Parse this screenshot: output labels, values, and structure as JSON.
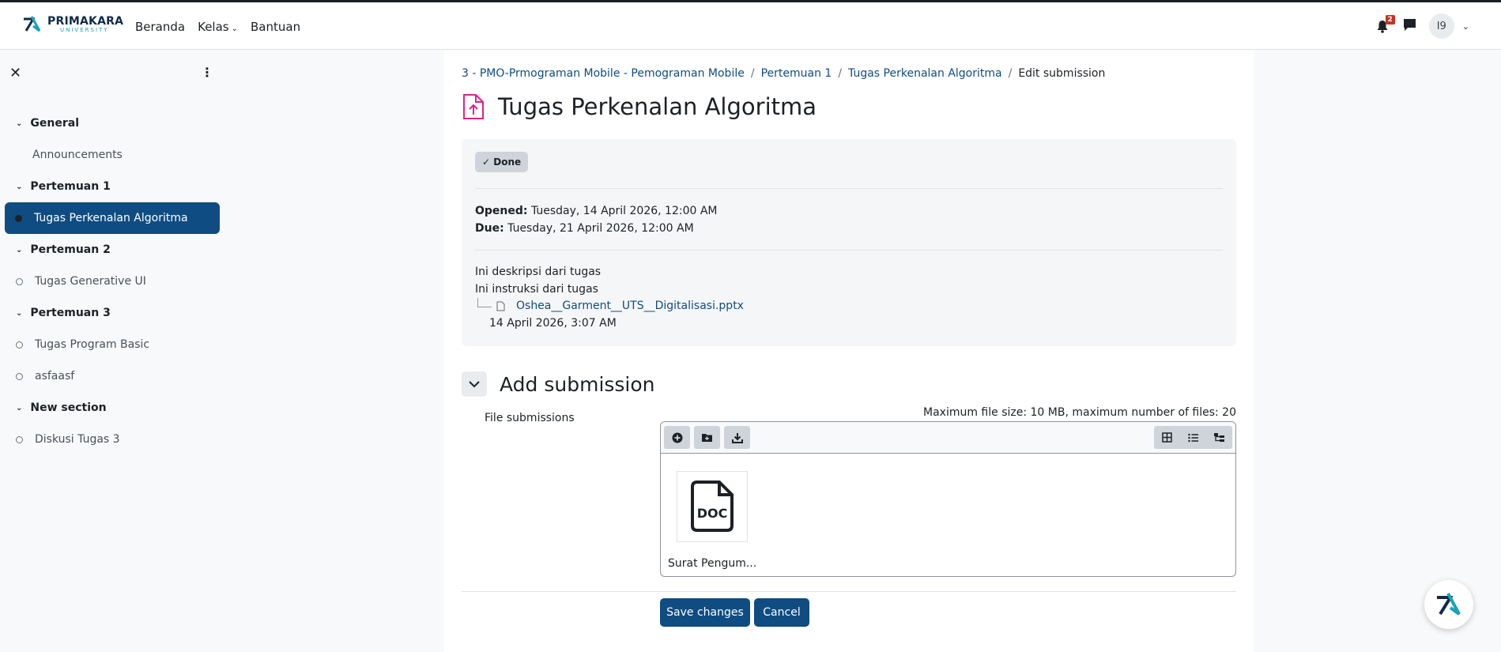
{
  "brand": {
    "name": "PRIMAKARA",
    "sub": "UNIVERSITY"
  },
  "nav": {
    "home": "Beranda",
    "classes": "Kelas",
    "help": "Bantuan"
  },
  "header": {
    "notification_count": "2",
    "user_initials": "I9"
  },
  "sidebar": {
    "sections": [
      {
        "title": "General",
        "items": [
          {
            "label": "Announcements"
          }
        ]
      },
      {
        "title": "Pertemuan 1",
        "items": [
          {
            "label": "Tugas Perkenalan Algoritma"
          }
        ]
      },
      {
        "title": "Pertemuan 2",
        "items": [
          {
            "label": "Tugas Generative UI"
          }
        ]
      },
      {
        "title": "Pertemuan 3",
        "items": [
          {
            "label": "Tugas Program Basic"
          },
          {
            "label": "asfaasf"
          }
        ]
      },
      {
        "title": "New section",
        "items": [
          {
            "label": "Diskusi Tugas 3"
          }
        ]
      }
    ]
  },
  "breadcrumb": {
    "course": "3 - PMO-Prmograman Mobile - Pemograman Mobile",
    "section": "Pertemuan 1",
    "activity": "Tugas Perkenalan Algoritma",
    "current": "Edit submission",
    "separator": "/"
  },
  "page": {
    "title": "Tugas Perkenalan Algoritma"
  },
  "assignment": {
    "status": "Done",
    "opened_label": "Opened:",
    "opened_value": "Tuesday, 14 April 2026, 12:00 AM",
    "due_label": "Due:",
    "due_value": "Tuesday, 21 April 2026, 12:00 AM",
    "description": "Ini deskripsi dari tugas",
    "instructions": "Ini instruksi dari tugas",
    "attachment_name": "Oshea__Garment__UTS__Digitalisasi.pptx",
    "attachment_date": "14 April 2026, 3:07 AM"
  },
  "submission": {
    "title": "Add submission",
    "field_label": "File submissions",
    "limits": "Maximum file size: 10 MB, maximum number of files: 20",
    "file_name": "Surat Pengum...",
    "file_type": "DOC"
  },
  "buttons": {
    "save": "Save changes",
    "cancel": "Cancel"
  },
  "colors": {
    "primary": "#0f4c81",
    "accent_icon": "#e0218a",
    "badge": "#ca3120"
  }
}
